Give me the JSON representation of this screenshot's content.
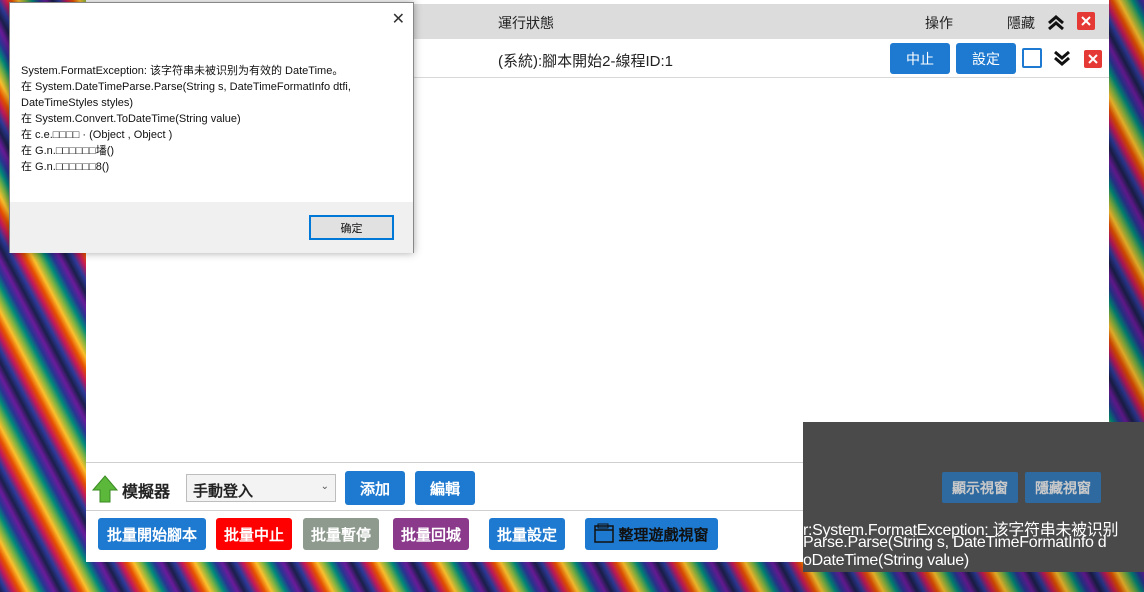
{
  "header": {
    "status_col": "運行狀態",
    "action_col": "操作",
    "hide_col": "隱藏"
  },
  "row": {
    "status": "(系統):腳本開始2-線程ID:1",
    "stop_label": "中止",
    "settings_label": "設定"
  },
  "toolbar": {
    "simulator_label": "模擬器",
    "simulator_selected": "手動登入",
    "add_label": "添加",
    "edit_label": "編輯"
  },
  "batch_buttons": {
    "start": "批量開始腳本",
    "stop": "批量中止",
    "pause": "批量暫停",
    "return": "批量回城",
    "settings": "批量設定",
    "arrange": "整理遊戲視窗"
  },
  "overlay": {
    "show_window": "顯示視窗",
    "hide_window": "隱藏視窗",
    "lines": [
      "r:System.FormatException: 该字符串未被识别",
      "Parse.Parse(String s, DateTimeFormatInfo d",
      "oDateTime(String value)"
    ]
  },
  "dialog": {
    "close_glyph": "✕",
    "lines": [
      "System.FormatException: 该字符串未被识别为有效的 DateTime。",
      "   在 System.DateTimeParse.Parse(String s, DateTimeFormatInfo dtfi,",
      "DateTimeStyles styles)",
      "   在 System.Convert.ToDateTime(String value)",
      "   在 c.e.□□□□ · (Object , Object )",
      "   在 G.n.□□□□□□墦()",
      "   在 G.n.□□□□□□8()"
    ],
    "ok_label": "确定"
  },
  "colors": {
    "primary_blue": "#1e7ad0",
    "danger_red": "#ff0000",
    "pause_gray": "#8d9a8d",
    "return_purple": "#8b3a8b"
  }
}
